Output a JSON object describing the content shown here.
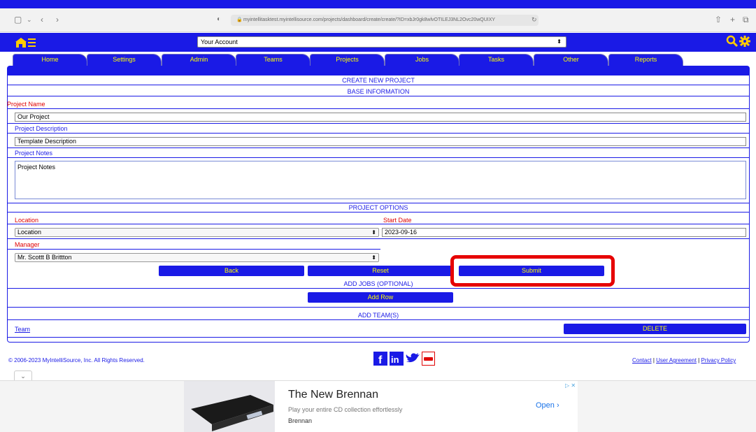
{
  "browser": {
    "url": "myintellitasktest.myintellisource.com/projects/dashboard/create/create/?ID=xbJr0gk8wlvOTILEJ3NL2Ovc20wQUIXY"
  },
  "header": {
    "account_label": "Your Account"
  },
  "tabs": [
    "Home",
    "Settings",
    "Admin",
    "Teams",
    "Projects",
    "Jobs",
    "Tasks",
    "Other",
    "Reports"
  ],
  "form": {
    "title": "CREATE NEW PROJECT",
    "base_info": "BASE INFORMATION",
    "project_name_label": "Project Name",
    "project_name_value": "Our Project",
    "project_description_label": "Project Description",
    "project_description_value": "Template Description",
    "project_notes_label": "Project Notes",
    "project_notes_value": "Project Notes",
    "project_options": "PROJECT OPTIONS",
    "location_label": "Location",
    "location_value": "Location",
    "start_date_label": "Start Date",
    "start_date_value": "2023-09-16",
    "manager_label": "Manager",
    "manager_value": "Mr. Scottt B Brittton",
    "back_label": "Back",
    "reset_label": "Reset",
    "submit_label": "Submit",
    "add_jobs": "ADD JOBS (OPTIONAL)",
    "add_row_label": "Add Row",
    "add_teams": "ADD TEAM(S)",
    "team_link": "Team",
    "delete_label": "DELETE"
  },
  "footer": {
    "copyright": "© 2006-2023 MyIntelliSource, Inc. All Rights Reserved.",
    "contact": "Contact",
    "user_agreement": "User Agreement",
    "privacy_policy": "Privacy Policy",
    "separator": "|"
  },
  "ad": {
    "title": "The New Brennan",
    "subtitle": "Play your entire CD collection effortlessly",
    "brand": "Brennan",
    "open_label": "Open ›"
  },
  "colors": {
    "brand_blue": "#1a1ae6",
    "tab_text": "#ffff00",
    "label_red": "#e00000",
    "highlight": "#e60000"
  }
}
